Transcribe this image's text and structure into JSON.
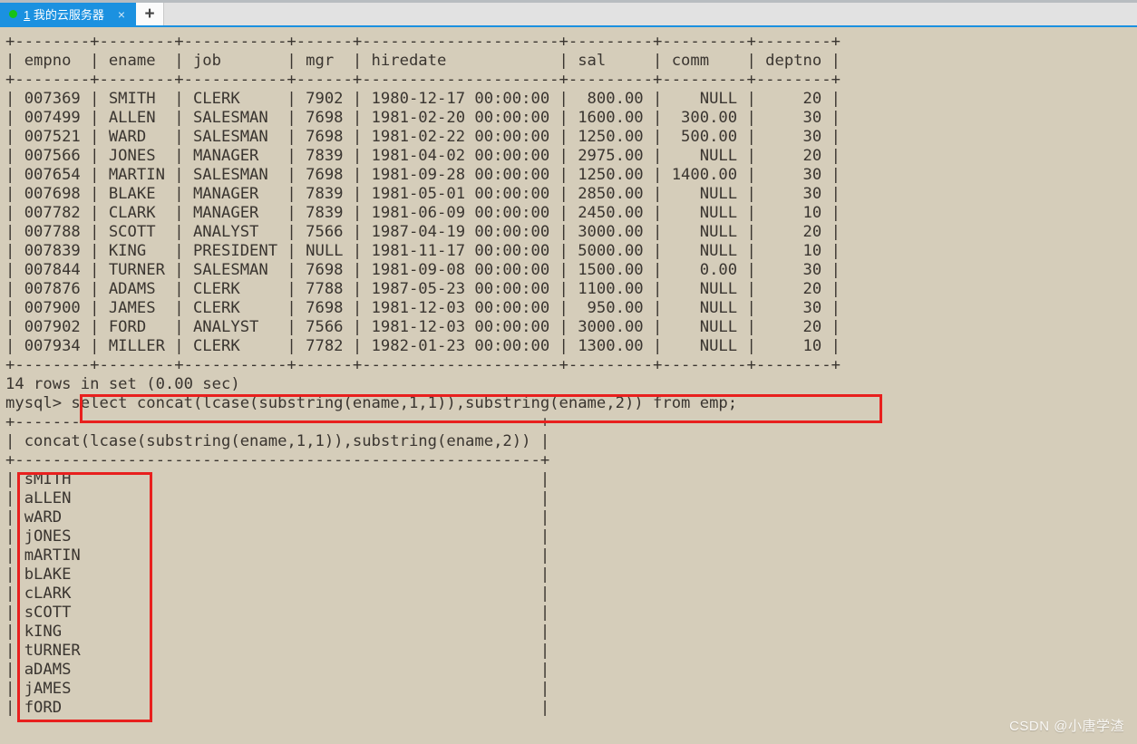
{
  "window": {
    "tab": {
      "number": "1",
      "title": "我的云服务器",
      "close_label": "×",
      "dot_color": "#17c217",
      "active_color": "#1b91e0"
    },
    "new_tab_label": "+"
  },
  "terminal": {
    "colors": {
      "background": "#d5cdba",
      "foreground": "#3a3530",
      "annotation": "#e8201e"
    },
    "emp_table": {
      "columns": [
        "empno",
        "ename",
        "job",
        "mgr",
        "hiredate",
        "sal",
        "comm",
        "deptno"
      ],
      "rows": [
        [
          "007369",
          "SMITH",
          "CLERK",
          "7902",
          "1980-12-17 00:00:00",
          "800.00",
          "NULL",
          "20"
        ],
        [
          "007499",
          "ALLEN",
          "SALESMAN",
          "7698",
          "1981-02-20 00:00:00",
          "1600.00",
          "300.00",
          "30"
        ],
        [
          "007521",
          "WARD",
          "SALESMAN",
          "7698",
          "1981-02-22 00:00:00",
          "1250.00",
          "500.00",
          "30"
        ],
        [
          "007566",
          "JONES",
          "MANAGER",
          "7839",
          "1981-04-02 00:00:00",
          "2975.00",
          "NULL",
          "20"
        ],
        [
          "007654",
          "MARTIN",
          "SALESMAN",
          "7698",
          "1981-09-28 00:00:00",
          "1250.00",
          "1400.00",
          "30"
        ],
        [
          "007698",
          "BLAKE",
          "MANAGER",
          "7839",
          "1981-05-01 00:00:00",
          "2850.00",
          "NULL",
          "30"
        ],
        [
          "007782",
          "CLARK",
          "MANAGER",
          "7839",
          "1981-06-09 00:00:00",
          "2450.00",
          "NULL",
          "10"
        ],
        [
          "007788",
          "SCOTT",
          "ANALYST",
          "7566",
          "1987-04-19 00:00:00",
          "3000.00",
          "NULL",
          "20"
        ],
        [
          "007839",
          "KING",
          "PRESIDENT",
          "NULL",
          "1981-11-17 00:00:00",
          "5000.00",
          "NULL",
          "10"
        ],
        [
          "007844",
          "TURNER",
          "SALESMAN",
          "7698",
          "1981-09-08 00:00:00",
          "1500.00",
          "0.00",
          "30"
        ],
        [
          "007876",
          "ADAMS",
          "CLERK",
          "7788",
          "1987-05-23 00:00:00",
          "1100.00",
          "NULL",
          "20"
        ],
        [
          "007900",
          "JAMES",
          "CLERK",
          "7698",
          "1981-12-03 00:00:00",
          "950.00",
          "NULL",
          "30"
        ],
        [
          "007902",
          "FORD",
          "ANALYST",
          "7566",
          "1981-12-03 00:00:00",
          "3000.00",
          "NULL",
          "20"
        ],
        [
          "007934",
          "MILLER",
          "CLERK",
          "7782",
          "1982-01-23 00:00:00",
          "1300.00",
          "NULL",
          "10"
        ]
      ],
      "status": "14 rows in set (0.00 sec)"
    },
    "prompt": "mysql>",
    "query": "select concat(lcase(substring(ename,1,1)),substring(ename,2)) from emp;",
    "result": {
      "column": "concat(lcase(substring(ename,1,1)),substring(ename,2))",
      "values": [
        "sMITH",
        "aLLEN",
        "wARD",
        "jONES",
        "mARTIN",
        "bLAKE",
        "cLARK",
        "sCOTT",
        "kING",
        "tURNER",
        "aDAMS",
        "jAMES",
        "fORD"
      ]
    }
  },
  "watermark": "CSDN @小唐学渣"
}
